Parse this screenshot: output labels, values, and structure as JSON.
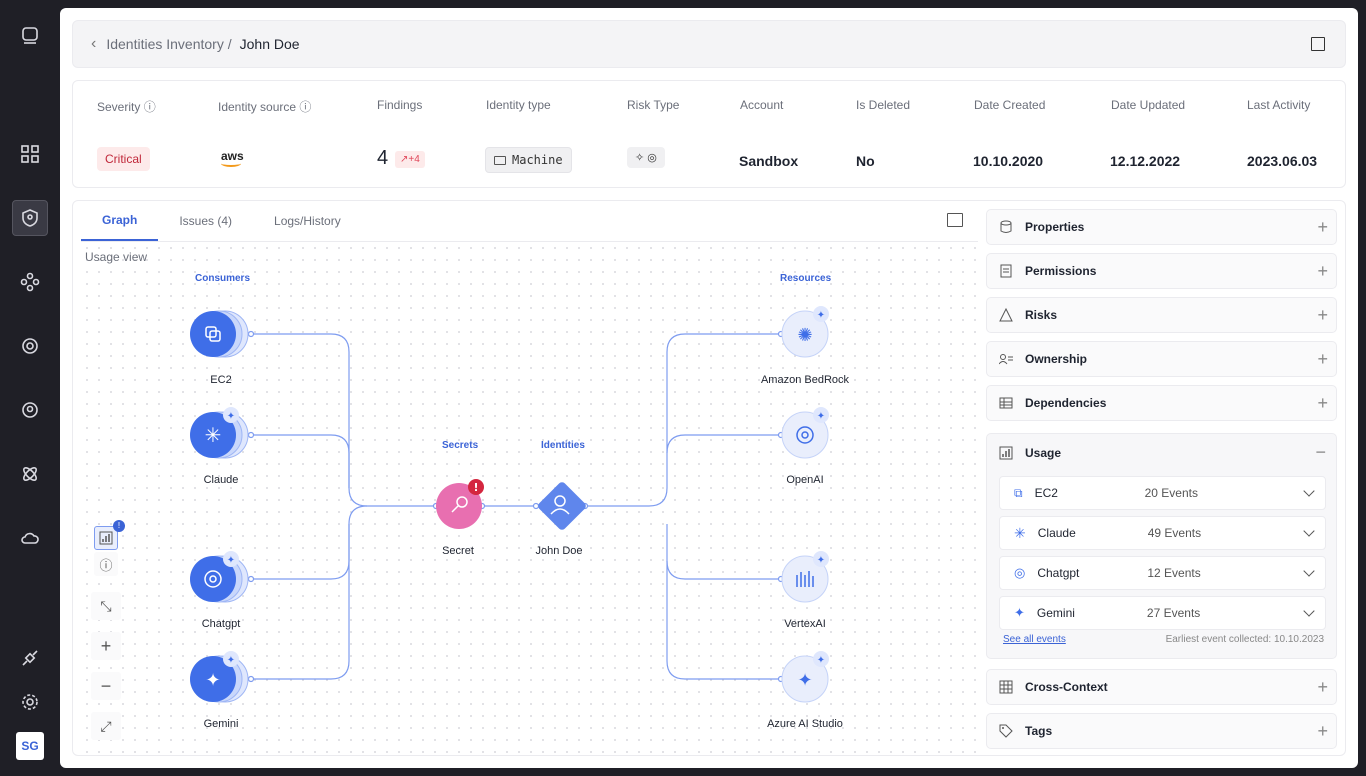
{
  "avatar": "SG",
  "breadcrumb": {
    "parent": "Identities Inventory /",
    "current": "John Doe"
  },
  "summary": {
    "severity_label": "Severity",
    "source_label": "Identity source",
    "findings_label": "Findings",
    "type_label": "Identity type",
    "risk_label": "Risk Type",
    "account_label": "Account",
    "deleted_label": "Is Deleted",
    "created_label": "Date Created",
    "updated_label": "Date Updated",
    "activity_label": "Last Activity",
    "severity": "Critical",
    "source": "aws",
    "findings": "4",
    "findings_trend": "↗+4",
    "type": "Machine",
    "risk": "✧ ◎",
    "account": "Sandbox",
    "deleted": "No",
    "created": "10.10.2020",
    "updated": "12.12.2022",
    "activity": "2023.06.03"
  },
  "tabs": [
    "Graph",
    "Issues (4)",
    "Logs/History"
  ],
  "graph": {
    "view": "Usage view",
    "groups": {
      "consumers": "Consumers",
      "secrets": "Secrets",
      "identities": "Identities",
      "resources": "Resources"
    },
    "consumers": [
      "EC2",
      "Claude",
      "Chatgpt",
      "Gemini"
    ],
    "secret": "Secret",
    "identity": "John Doe",
    "resources": [
      "Amazon BedRock",
      "OpenAI",
      "VertexAI",
      "Azure AI Studio"
    ]
  },
  "panel": {
    "sections": [
      "Properties",
      "Permissions",
      "Risks",
      "Ownership",
      "Dependencies"
    ],
    "usage_title": "Usage",
    "usage": [
      {
        "name": "EC2",
        "events": "20 Events"
      },
      {
        "name": "Claude",
        "events": "49 Events"
      },
      {
        "name": "Chatgpt",
        "events": "12 Events"
      },
      {
        "name": "Gemini",
        "events": "27 Events"
      }
    ],
    "see_all": "See all events",
    "earliest": "Earliest event collected: 10.10.2023",
    "after": [
      "Cross-Context",
      "Tags"
    ]
  },
  "colors": {
    "accent": "#3b63d6",
    "node": "#3f6ee8",
    "secret": "#e86fb0",
    "critical": "#c0283a"
  }
}
